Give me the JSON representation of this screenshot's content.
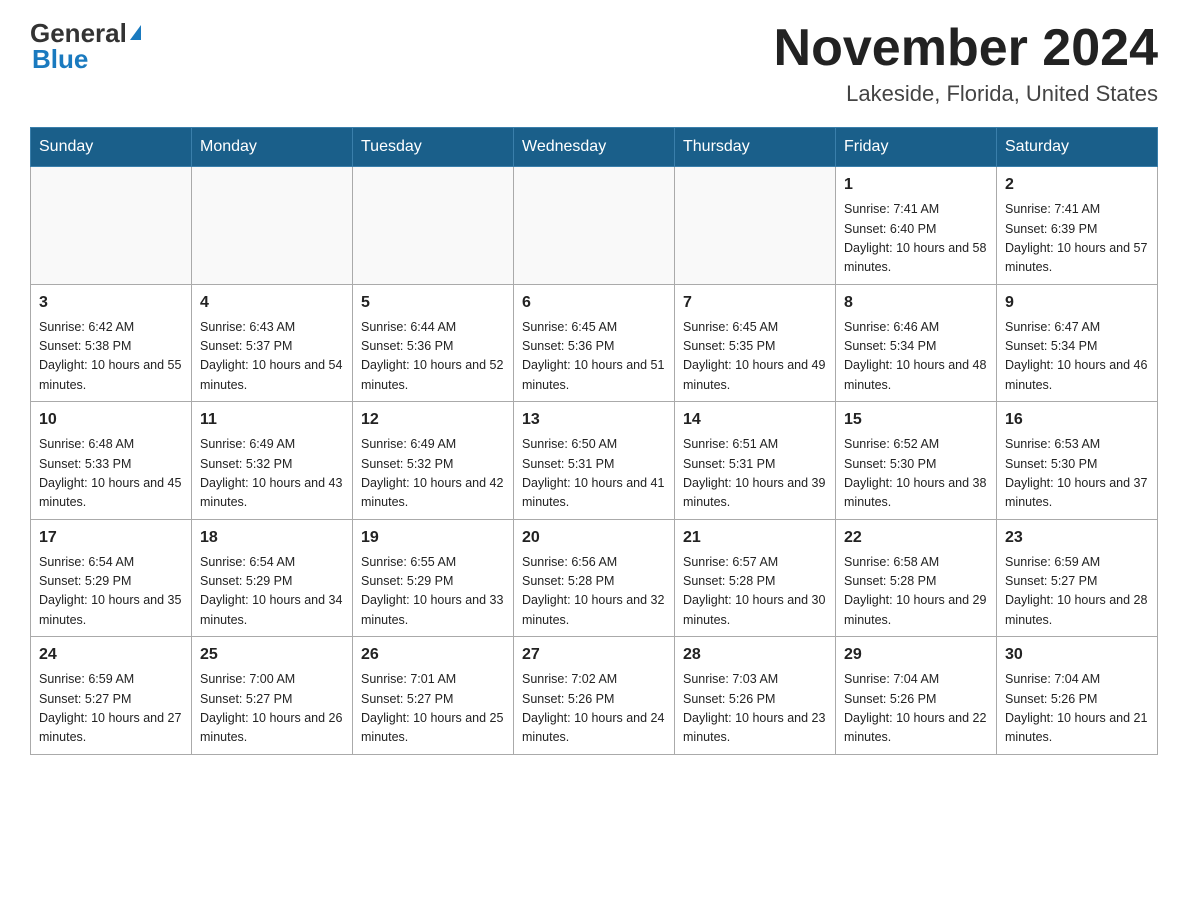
{
  "logo": {
    "general": "General",
    "blue": "Blue"
  },
  "header": {
    "month": "November 2024",
    "location": "Lakeside, Florida, United States"
  },
  "weekdays": [
    "Sunday",
    "Monday",
    "Tuesday",
    "Wednesday",
    "Thursday",
    "Friday",
    "Saturday"
  ],
  "weeks": [
    [
      {
        "day": null
      },
      {
        "day": null
      },
      {
        "day": null
      },
      {
        "day": null
      },
      {
        "day": null
      },
      {
        "day": "1",
        "sunrise": "Sunrise: 7:41 AM",
        "sunset": "Sunset: 6:40 PM",
        "daylight": "Daylight: 10 hours and 58 minutes."
      },
      {
        "day": "2",
        "sunrise": "Sunrise: 7:41 AM",
        "sunset": "Sunset: 6:39 PM",
        "daylight": "Daylight: 10 hours and 57 minutes."
      }
    ],
    [
      {
        "day": "3",
        "sunrise": "Sunrise: 6:42 AM",
        "sunset": "Sunset: 5:38 PM",
        "daylight": "Daylight: 10 hours and 55 minutes."
      },
      {
        "day": "4",
        "sunrise": "Sunrise: 6:43 AM",
        "sunset": "Sunset: 5:37 PM",
        "daylight": "Daylight: 10 hours and 54 minutes."
      },
      {
        "day": "5",
        "sunrise": "Sunrise: 6:44 AM",
        "sunset": "Sunset: 5:36 PM",
        "daylight": "Daylight: 10 hours and 52 minutes."
      },
      {
        "day": "6",
        "sunrise": "Sunrise: 6:45 AM",
        "sunset": "Sunset: 5:36 PM",
        "daylight": "Daylight: 10 hours and 51 minutes."
      },
      {
        "day": "7",
        "sunrise": "Sunrise: 6:45 AM",
        "sunset": "Sunset: 5:35 PM",
        "daylight": "Daylight: 10 hours and 49 minutes."
      },
      {
        "day": "8",
        "sunrise": "Sunrise: 6:46 AM",
        "sunset": "Sunset: 5:34 PM",
        "daylight": "Daylight: 10 hours and 48 minutes."
      },
      {
        "day": "9",
        "sunrise": "Sunrise: 6:47 AM",
        "sunset": "Sunset: 5:34 PM",
        "daylight": "Daylight: 10 hours and 46 minutes."
      }
    ],
    [
      {
        "day": "10",
        "sunrise": "Sunrise: 6:48 AM",
        "sunset": "Sunset: 5:33 PM",
        "daylight": "Daylight: 10 hours and 45 minutes."
      },
      {
        "day": "11",
        "sunrise": "Sunrise: 6:49 AM",
        "sunset": "Sunset: 5:32 PM",
        "daylight": "Daylight: 10 hours and 43 minutes."
      },
      {
        "day": "12",
        "sunrise": "Sunrise: 6:49 AM",
        "sunset": "Sunset: 5:32 PM",
        "daylight": "Daylight: 10 hours and 42 minutes."
      },
      {
        "day": "13",
        "sunrise": "Sunrise: 6:50 AM",
        "sunset": "Sunset: 5:31 PM",
        "daylight": "Daylight: 10 hours and 41 minutes."
      },
      {
        "day": "14",
        "sunrise": "Sunrise: 6:51 AM",
        "sunset": "Sunset: 5:31 PM",
        "daylight": "Daylight: 10 hours and 39 minutes."
      },
      {
        "day": "15",
        "sunrise": "Sunrise: 6:52 AM",
        "sunset": "Sunset: 5:30 PM",
        "daylight": "Daylight: 10 hours and 38 minutes."
      },
      {
        "day": "16",
        "sunrise": "Sunrise: 6:53 AM",
        "sunset": "Sunset: 5:30 PM",
        "daylight": "Daylight: 10 hours and 37 minutes."
      }
    ],
    [
      {
        "day": "17",
        "sunrise": "Sunrise: 6:54 AM",
        "sunset": "Sunset: 5:29 PM",
        "daylight": "Daylight: 10 hours and 35 minutes."
      },
      {
        "day": "18",
        "sunrise": "Sunrise: 6:54 AM",
        "sunset": "Sunset: 5:29 PM",
        "daylight": "Daylight: 10 hours and 34 minutes."
      },
      {
        "day": "19",
        "sunrise": "Sunrise: 6:55 AM",
        "sunset": "Sunset: 5:29 PM",
        "daylight": "Daylight: 10 hours and 33 minutes."
      },
      {
        "day": "20",
        "sunrise": "Sunrise: 6:56 AM",
        "sunset": "Sunset: 5:28 PM",
        "daylight": "Daylight: 10 hours and 32 minutes."
      },
      {
        "day": "21",
        "sunrise": "Sunrise: 6:57 AM",
        "sunset": "Sunset: 5:28 PM",
        "daylight": "Daylight: 10 hours and 30 minutes."
      },
      {
        "day": "22",
        "sunrise": "Sunrise: 6:58 AM",
        "sunset": "Sunset: 5:28 PM",
        "daylight": "Daylight: 10 hours and 29 minutes."
      },
      {
        "day": "23",
        "sunrise": "Sunrise: 6:59 AM",
        "sunset": "Sunset: 5:27 PM",
        "daylight": "Daylight: 10 hours and 28 minutes."
      }
    ],
    [
      {
        "day": "24",
        "sunrise": "Sunrise: 6:59 AM",
        "sunset": "Sunset: 5:27 PM",
        "daylight": "Daylight: 10 hours and 27 minutes."
      },
      {
        "day": "25",
        "sunrise": "Sunrise: 7:00 AM",
        "sunset": "Sunset: 5:27 PM",
        "daylight": "Daylight: 10 hours and 26 minutes."
      },
      {
        "day": "26",
        "sunrise": "Sunrise: 7:01 AM",
        "sunset": "Sunset: 5:27 PM",
        "daylight": "Daylight: 10 hours and 25 minutes."
      },
      {
        "day": "27",
        "sunrise": "Sunrise: 7:02 AM",
        "sunset": "Sunset: 5:26 PM",
        "daylight": "Daylight: 10 hours and 24 minutes."
      },
      {
        "day": "28",
        "sunrise": "Sunrise: 7:03 AM",
        "sunset": "Sunset: 5:26 PM",
        "daylight": "Daylight: 10 hours and 23 minutes."
      },
      {
        "day": "29",
        "sunrise": "Sunrise: 7:04 AM",
        "sunset": "Sunset: 5:26 PM",
        "daylight": "Daylight: 10 hours and 22 minutes."
      },
      {
        "day": "30",
        "sunrise": "Sunrise: 7:04 AM",
        "sunset": "Sunset: 5:26 PM",
        "daylight": "Daylight: 10 hours and 21 minutes."
      }
    ]
  ]
}
